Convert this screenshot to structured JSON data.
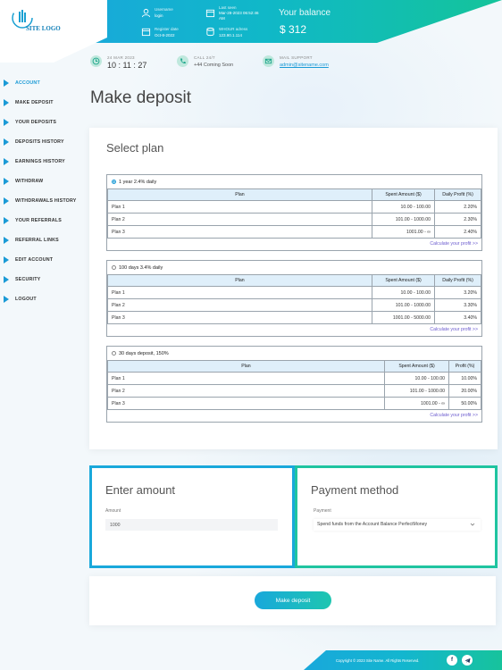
{
  "brand": {
    "logo_text": "SITE LOGO"
  },
  "header": {
    "username": {
      "label": "Username",
      "value": "login"
    },
    "last_seen": {
      "label": "Last seen",
      "value_line1": "Mar-28-2023 06:52:46",
      "value_line2": "AM"
    },
    "register_date": {
      "label": "Register date",
      "value": "Oct-8-2022"
    },
    "ip": {
      "label": "WHOUR adress",
      "value": "123.90.1.114"
    },
    "balance_label": "Your balance",
    "balance_value": "$ 312"
  },
  "info": {
    "date": "24 MAR 2023",
    "time": "10 : 11 : 27",
    "call_label": "CALL 24/7",
    "call_value": "+44 Coming Soon",
    "mail_label": "MAIL SUPPORT",
    "mail_value": "admin@sitename.com"
  },
  "sidebar": {
    "items": [
      {
        "label": "ACCOUNT",
        "active": true
      },
      {
        "label": "MAKE DEPOSIT"
      },
      {
        "label": "YOUR DEPOSITS"
      },
      {
        "label": "DEPOSITS HISTORY"
      },
      {
        "label": "EARNINGS HISTORY"
      },
      {
        "label": "WITHDRAW"
      },
      {
        "label": "WITHDRAWALS HISTORY"
      },
      {
        "label": "YOUR REFERRALS"
      },
      {
        "label": "REFERRAL LINKS"
      },
      {
        "label": "EDIT ACCOUNT"
      },
      {
        "label": "SECURITY"
      },
      {
        "label": "LOGOUT"
      }
    ]
  },
  "page_title": "Make deposit",
  "select_plan": {
    "title": "Select plan",
    "groups": [
      {
        "name": "1 year 2.4% daily",
        "selected": true,
        "headers": [
          "Plan",
          "Spent Amount ($)",
          "Daily Profit (%)"
        ],
        "rows": [
          [
            "Plan 1",
            "10.00 - 100.00",
            "2.20%"
          ],
          [
            "Plan 2",
            "101.00 - 1000.00",
            "2.30%"
          ],
          [
            "Plan 3",
            "1001.00 - ∞",
            "2.40%"
          ]
        ],
        "calc_link": "Calculate your profit >>"
      },
      {
        "name": "100 days 3.4% daily",
        "selected": false,
        "headers": [
          "Plan",
          "Spent Amount ($)",
          "Daily Profit (%)"
        ],
        "rows": [
          [
            "Plan 1",
            "10.00 - 100.00",
            "3.20%"
          ],
          [
            "Plan 2",
            "101.00 - 1000.00",
            "3.30%"
          ],
          [
            "Plan 3",
            "1001.00 - 5000.00",
            "3.40%"
          ]
        ],
        "calc_link": "Calculate your profit >>"
      },
      {
        "name": "30 days deposit, 150%",
        "selected": false,
        "headers": [
          "Plan",
          "Spent Amount ($)",
          "Profit (%)"
        ],
        "rows": [
          [
            "Plan 1",
            "10.00 - 100.00",
            "10.00%"
          ],
          [
            "Plan 2",
            "101.00 - 1000.00",
            "20.00%"
          ],
          [
            "Plan 3",
            "1001.00 - ∞",
            "50.00%"
          ]
        ],
        "calc_link": "Calculate your profit >>"
      }
    ]
  },
  "amount": {
    "title": "Enter amount",
    "label": "Amount",
    "value": "1000"
  },
  "payment": {
    "title": "Payment method",
    "label": "Payment",
    "selected": "Spend funds from the Account Balance PerfectMoney"
  },
  "submit": {
    "label": "Make deposit"
  },
  "footer": {
    "copyright": "Copyright © 2023 Site Name. All Rights Reserved.",
    "social": [
      "facebook",
      "telegram"
    ]
  },
  "colors": {
    "accent_blue": "#19a8db",
    "accent_green": "#1fc4a0",
    "link_purple": "#6c5ccf"
  }
}
